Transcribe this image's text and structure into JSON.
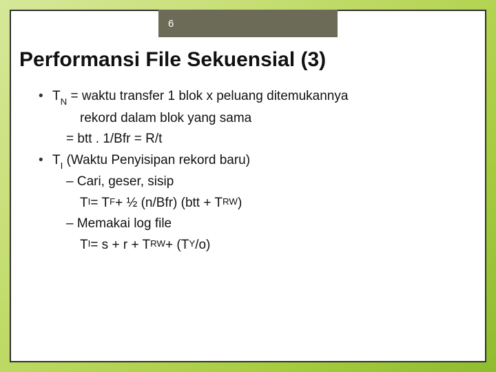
{
  "page_number": "6",
  "title": "Performansi File Sekuensial (3)",
  "bullets": {
    "b1_line1_pre": "T",
    "b1_line1_sub": "N",
    "b1_line1_post": " = waktu transfer 1 blok x peluang ditemukannya",
    "b1_line2": "rekord dalam blok yang sama",
    "b1_line3": "= btt . 1/Bfr = R/t",
    "b2_line1_pre": "T",
    "b2_line1_sub": "I",
    "b2_line1_post": " (Waktu Penyisipan rekord baru)",
    "b2_line2": "– Cari, geser, sisip",
    "b2_line3_preA": "T",
    "b2_line3_subA": "I",
    "b2_line3_mid1": " = T",
    "b2_line3_subB": "F",
    "b2_line3_mid2": " + ½ (n/Bfr) (btt + T",
    "b2_line3_subC": "RW",
    "b2_line3_end": ")",
    "b2_line4": "– Memakai log file",
    "b2_line5_preA": "T",
    "b2_line5_subA": "I",
    "b2_line5_mid1": " = s + r + T",
    "b2_line5_subB": "RW",
    "b2_line5_mid2": " + (T",
    "b2_line5_subC": "Y",
    "b2_line5_end": "/o)"
  }
}
